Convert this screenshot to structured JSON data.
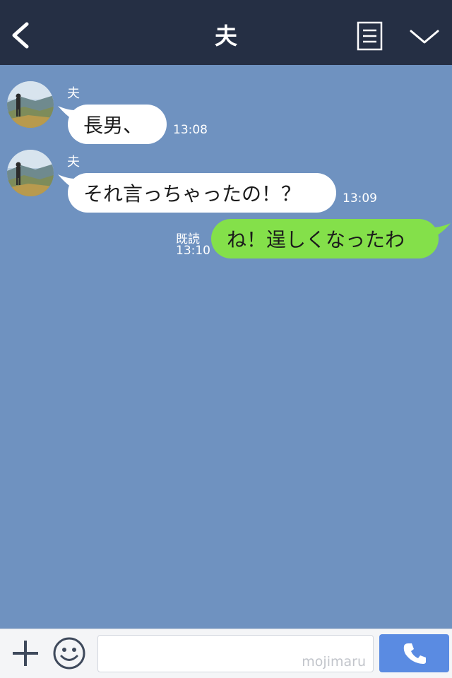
{
  "header": {
    "title": "夫",
    "back_icon": "chevron-left-icon",
    "notes_icon": "note-icon",
    "menu_icon": "chevron-down-icon",
    "background": "#252f44"
  },
  "chat": {
    "background": "#6f92c0",
    "messages": [
      {
        "direction": "incoming",
        "sender": "夫",
        "text": "長男、",
        "time": "13:08"
      },
      {
        "direction": "incoming",
        "sender": "夫",
        "text": "それ言っちゃったの！？",
        "time": "13:09"
      },
      {
        "direction": "outgoing",
        "text": "ね！逞しくなったわ",
        "read": "既読",
        "time": "13:10"
      }
    ]
  },
  "footer": {
    "plus_icon": "plus-icon",
    "emoji_icon": "smiley-icon",
    "input_watermark": "mojimaru",
    "call_icon": "phone-icon",
    "call_color": "#5a8be2"
  },
  "colors": {
    "incoming_bubble": "#ffffff",
    "outgoing_bubble": "#84e04a"
  }
}
